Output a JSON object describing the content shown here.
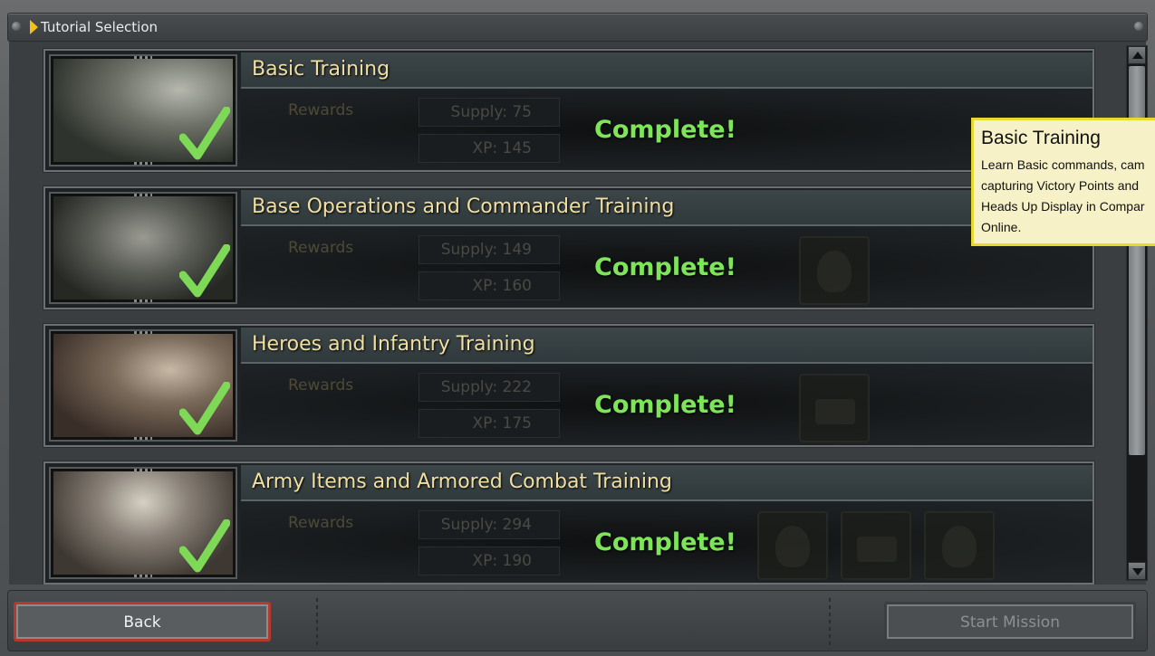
{
  "window": {
    "title": "Tutorial Selection"
  },
  "missions": [
    {
      "title": "Basic Training",
      "rewards_label": "Rewards",
      "supply": "Supply: 75",
      "xp": "XP: 145",
      "status": "Complete!"
    },
    {
      "title": "Base Operations and Commander Training",
      "rewards_label": "Rewards",
      "supply": "Supply: 149",
      "xp": "XP: 160",
      "status": "Complete!"
    },
    {
      "title": "Heroes and Infantry Training",
      "rewards_label": "Rewards",
      "supply": "Supply: 222",
      "xp": "XP: 175",
      "status": "Complete!"
    },
    {
      "title": "Army Items and Armored Combat Training",
      "rewards_label": "Rewards",
      "supply": "Supply: 294",
      "xp": "XP: 190",
      "status": "Complete!"
    }
  ],
  "tooltip": {
    "title": "Basic Training",
    "description": "Learn Basic commands, cam\ncapturing Victory Points and\nHeads Up Display in Compar\nOnline."
  },
  "buttons": {
    "back": "Back",
    "start": "Start Mission"
  },
  "colors": {
    "accent": "#f3c01a",
    "complete": "#7ee55a",
    "title_text": "#f0dfa0",
    "tooltip_border": "#e6d930"
  }
}
